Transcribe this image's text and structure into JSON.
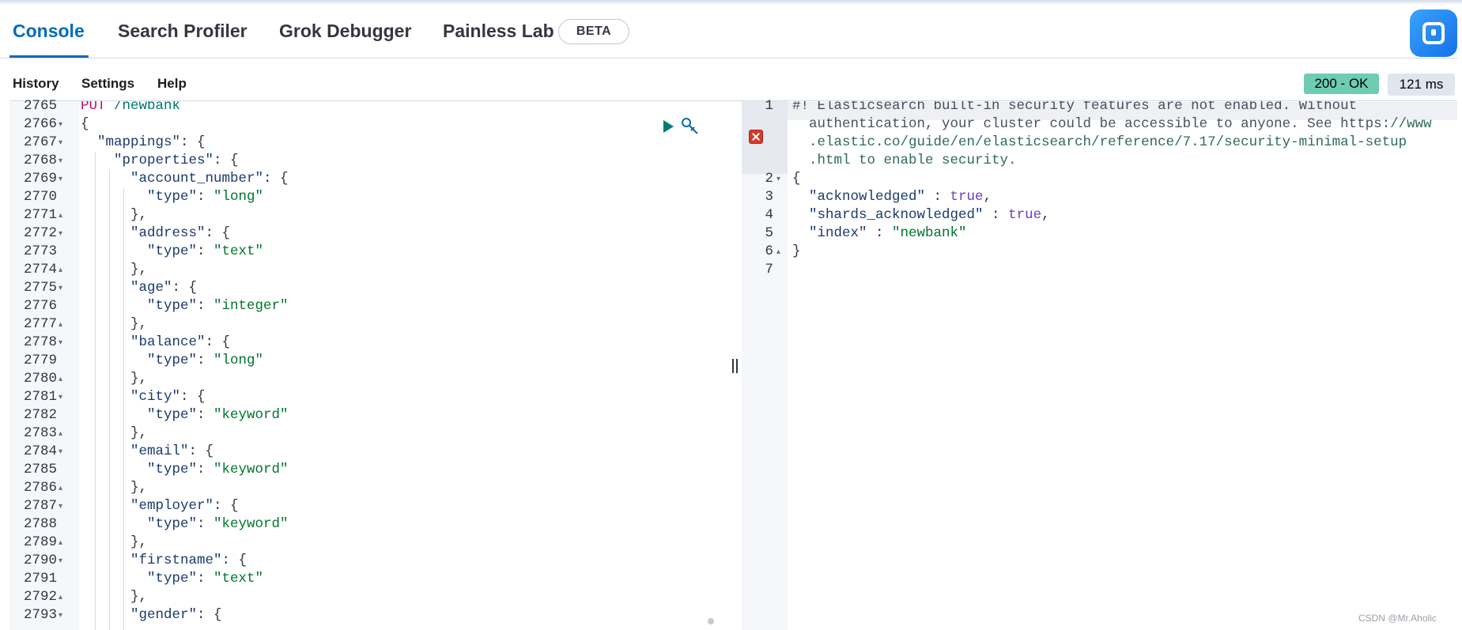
{
  "tabs": [
    {
      "label": "Console",
      "active": true
    },
    {
      "label": "Search Profiler"
    },
    {
      "label": "Grok Debugger"
    },
    {
      "label": "Painless Lab"
    }
  ],
  "beta_label": "BETA",
  "submenu": {
    "history": "History",
    "settings": "Settings",
    "help": "Help"
  },
  "status": {
    "code": "200 - OK",
    "time": "121 ms"
  },
  "request": {
    "lines": [
      {
        "n": "2765",
        "fold": "",
        "text": [
          [
            "k-method",
            "PUT"
          ],
          [
            "k-url",
            " /newbank"
          ]
        ]
      },
      {
        "n": "2766",
        "fold": "▾",
        "text": [
          [
            "k-punc",
            "{"
          ]
        ]
      },
      {
        "n": "2767",
        "fold": "▾",
        "text": [
          [
            "k-key",
            "  \"mappings\""
          ],
          [
            "k-punc",
            ": {"
          ]
        ]
      },
      {
        "n": "2768",
        "fold": "▾",
        "text": [
          [
            "k-key",
            "    \"properties\""
          ],
          [
            "k-punc",
            ": {"
          ]
        ]
      },
      {
        "n": "2769",
        "fold": "▾",
        "text": [
          [
            "k-key",
            "      \"account_number\""
          ],
          [
            "k-punc",
            ": {"
          ]
        ]
      },
      {
        "n": "2770",
        "fold": "",
        "text": [
          [
            "k-key",
            "        \"type\""
          ],
          [
            "k-punc",
            ": "
          ],
          [
            "k-str",
            "\"long\""
          ]
        ]
      },
      {
        "n": "2771",
        "fold": "▴",
        "text": [
          [
            "k-punc",
            "      },"
          ]
        ]
      },
      {
        "n": "2772",
        "fold": "▾",
        "text": [
          [
            "k-key",
            "      \"address\""
          ],
          [
            "k-punc",
            ": {"
          ]
        ]
      },
      {
        "n": "2773",
        "fold": "",
        "text": [
          [
            "k-key",
            "        \"type\""
          ],
          [
            "k-punc",
            ": "
          ],
          [
            "k-str",
            "\"text\""
          ]
        ]
      },
      {
        "n": "2774",
        "fold": "▴",
        "text": [
          [
            "k-punc",
            "      },"
          ]
        ]
      },
      {
        "n": "2775",
        "fold": "▾",
        "text": [
          [
            "k-key",
            "      \"age\""
          ],
          [
            "k-punc",
            ": {"
          ]
        ]
      },
      {
        "n": "2776",
        "fold": "",
        "text": [
          [
            "k-key",
            "        \"type\""
          ],
          [
            "k-punc",
            ": "
          ],
          [
            "k-str",
            "\"integer\""
          ]
        ]
      },
      {
        "n": "2777",
        "fold": "▴",
        "text": [
          [
            "k-punc",
            "      },"
          ]
        ]
      },
      {
        "n": "2778",
        "fold": "▾",
        "text": [
          [
            "k-key",
            "      \"balance\""
          ],
          [
            "k-punc",
            ": {"
          ]
        ]
      },
      {
        "n": "2779",
        "fold": "",
        "text": [
          [
            "k-key",
            "        \"type\""
          ],
          [
            "k-punc",
            ": "
          ],
          [
            "k-str",
            "\"long\""
          ]
        ]
      },
      {
        "n": "2780",
        "fold": "▴",
        "text": [
          [
            "k-punc",
            "      },"
          ]
        ]
      },
      {
        "n": "2781",
        "fold": "▾",
        "text": [
          [
            "k-key",
            "      \"city\""
          ],
          [
            "k-punc",
            ": {"
          ]
        ]
      },
      {
        "n": "2782",
        "fold": "",
        "text": [
          [
            "k-key",
            "        \"type\""
          ],
          [
            "k-punc",
            ": "
          ],
          [
            "k-str",
            "\"keyword\""
          ]
        ]
      },
      {
        "n": "2783",
        "fold": "▴",
        "text": [
          [
            "k-punc",
            "      },"
          ]
        ]
      },
      {
        "n": "2784",
        "fold": "▾",
        "text": [
          [
            "k-key",
            "      \"email\""
          ],
          [
            "k-punc",
            ": {"
          ]
        ]
      },
      {
        "n": "2785",
        "fold": "",
        "text": [
          [
            "k-key",
            "        \"type\""
          ],
          [
            "k-punc",
            ": "
          ],
          [
            "k-str",
            "\"keyword\""
          ]
        ]
      },
      {
        "n": "2786",
        "fold": "▴",
        "text": [
          [
            "k-punc",
            "      },"
          ]
        ]
      },
      {
        "n": "2787",
        "fold": "▾",
        "text": [
          [
            "k-key",
            "      \"employer\""
          ],
          [
            "k-punc",
            ": {"
          ]
        ]
      },
      {
        "n": "2788",
        "fold": "",
        "text": [
          [
            "k-key",
            "        \"type\""
          ],
          [
            "k-punc",
            ": "
          ],
          [
            "k-str",
            "\"keyword\""
          ]
        ]
      },
      {
        "n": "2789",
        "fold": "▴",
        "text": [
          [
            "k-punc",
            "      },"
          ]
        ]
      },
      {
        "n": "2790",
        "fold": "▾",
        "text": [
          [
            "k-key",
            "      \"firstname\""
          ],
          [
            "k-punc",
            ": {"
          ]
        ]
      },
      {
        "n": "2791",
        "fold": "",
        "text": [
          [
            "k-key",
            "        \"type\""
          ],
          [
            "k-punc",
            ": "
          ],
          [
            "k-str",
            "\"text\""
          ]
        ]
      },
      {
        "n": "2792",
        "fold": "▴",
        "text": [
          [
            "k-punc",
            "      },"
          ]
        ]
      },
      {
        "n": "2793",
        "fold": "▾",
        "text": [
          [
            "k-key",
            "      \"gender\""
          ],
          [
            "k-punc",
            ": {"
          ]
        ]
      }
    ]
  },
  "response": {
    "lines": [
      {
        "n": "1",
        "fold": "",
        "text": [
          [
            "k-comment",
            "#! Elasticsearch built-in security features are not enabled. Without"
          ]
        ]
      },
      {
        "n": "",
        "fold": "",
        "text": [
          [
            "k-comment",
            "  authentication, your cluster could be accessible to anyone. See https:"
          ],
          [
            "k-link",
            "//www"
          ]
        ]
      },
      {
        "n": "",
        "fold": "",
        "text": [
          [
            "k-link",
            "  .elastic.co/guide/en/elasticsearch/reference/7.17/security-minimal-setup"
          ]
        ]
      },
      {
        "n": "",
        "fold": "",
        "text": [
          [
            "k-link",
            "  .html to enable security."
          ]
        ]
      },
      {
        "n": "2",
        "fold": "▾",
        "text": [
          [
            "k-punc",
            "{"
          ]
        ]
      },
      {
        "n": "3",
        "fold": "",
        "text": [
          [
            "k-key",
            "  \"acknowledged\""
          ],
          [
            "k-punc",
            " : "
          ],
          [
            "k-bool",
            "true"
          ],
          [
            "k-punc",
            ","
          ]
        ]
      },
      {
        "n": "4",
        "fold": "",
        "text": [
          [
            "k-key",
            "  \"shards_acknowledged\""
          ],
          [
            "k-punc",
            " : "
          ],
          [
            "k-bool",
            "true"
          ],
          [
            "k-punc",
            ","
          ]
        ]
      },
      {
        "n": "5",
        "fold": "",
        "text": [
          [
            "k-key",
            "  \"index\""
          ],
          [
            "k-punc",
            " : "
          ],
          [
            "k-str",
            "\"newbank\""
          ]
        ]
      },
      {
        "n": "6",
        "fold": "▴",
        "text": [
          [
            "k-punc",
            "}"
          ]
        ]
      },
      {
        "n": "7",
        "fold": "",
        "text": []
      }
    ]
  },
  "icons": {
    "run": "play-icon",
    "wrench": "wrench-icon",
    "app": "app-icon",
    "error": "error-icon"
  },
  "colors": {
    "accent": "#006bb8",
    "status_ok": "#6dccb1"
  },
  "watermark": "CSDN @Mr.Aholic"
}
